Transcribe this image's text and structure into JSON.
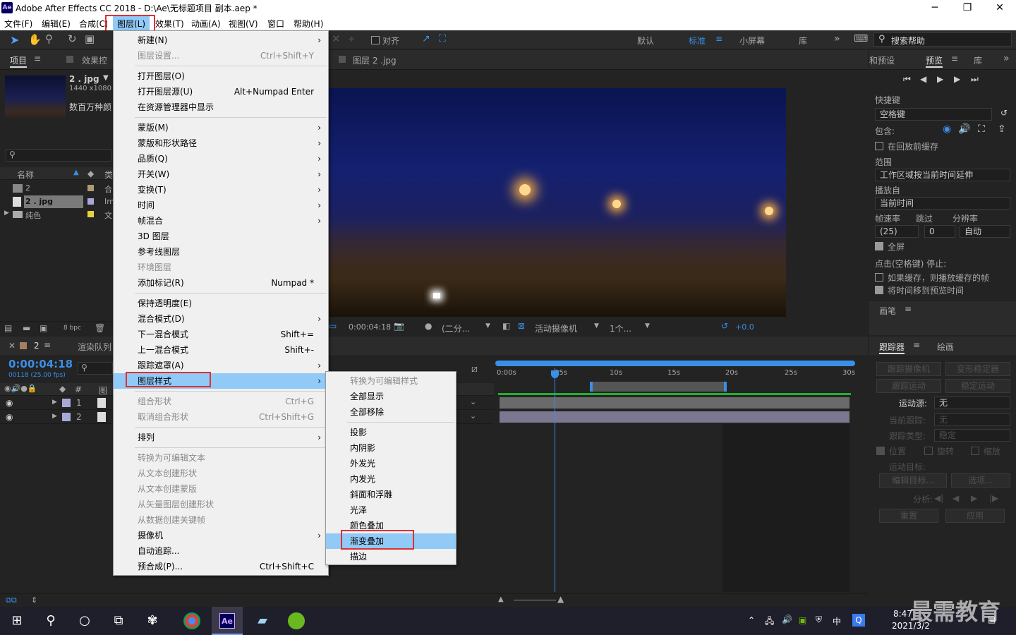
{
  "window": {
    "title": "Adobe After Effects CC 2018 - D:\\Ae\\无标题项目 副本.aep *",
    "logo": "Ae",
    "min": "─",
    "max": "❐",
    "close": "✕"
  },
  "menubar": [
    "文件(F)",
    "编辑(E)",
    "合成(C)",
    "图层(L)",
    "效果(T)",
    "动画(A)",
    "视图(V)",
    "窗口",
    "帮助(H)"
  ],
  "toolbar": {
    "snap": "对齐",
    "workspaces": [
      "默认",
      "标准",
      "小屏幕",
      "库"
    ],
    "active_ws": "标准",
    "search_placeholder": "搜索帮助"
  },
  "project": {
    "tab": "项目",
    "effects_tab": "效果控",
    "thumb_name": "2 . jpg",
    "thumb_res": "1440 x1080",
    "thumb_desc": "数百万种颜",
    "col_name": "名称",
    "col_type": "类",
    "items": [
      {
        "name": "2",
        "type": "合"
      },
      {
        "name": "2 . jpg",
        "type": "Im"
      },
      {
        "name": "纯色",
        "type": "文"
      }
    ],
    "bpc": "8 bpc"
  },
  "viewer": {
    "tab": "图层 2 .jpg",
    "time": "0:00:04:18",
    "res": "(二分...",
    "camera": "活动摄像机",
    "views": "1个...",
    "offset": "+0.0"
  },
  "timeline": {
    "tab": "2",
    "render_tab": "渲染队列",
    "timecode": "0:00:04:18",
    "fps": "00118 (25.00 fps)",
    "col_hash": "#",
    "col_layer": "图",
    "rows": [
      "1",
      "2"
    ],
    "ruler": [
      "0:00s",
      "05s",
      "10s",
      "15s",
      "20s",
      "25s",
      "30s"
    ]
  },
  "right": {
    "tab_presets": "和预设",
    "tab_preview": "预览",
    "tab_lib": "库",
    "shortcut_label": "快捷键",
    "shortcut_value": "空格键",
    "include_label": "包含:",
    "cache_before": "在回放前缓存",
    "range_label": "范围",
    "range_value": "工作区域按当前时间延伸",
    "play_from_label": "播放自",
    "play_from_value": "当前时间",
    "fps_label": "帧速率",
    "skip_label": "跳过",
    "res_label": "分辨率",
    "fps_value": "(25)",
    "skip_value": "0",
    "res_value": "自动",
    "fullscreen": "全屏",
    "stop_label": "点击(空格键) 停止:",
    "cache_play": "如果缓存，则播放缓存的帧",
    "move_time": "将时间移到预览时间",
    "paint_tab": "画笔",
    "tracker_tab": "跟踪器",
    "brush_tab": "绘画",
    "track_camera": "跟踪摄像机",
    "warp_stab": "变形稳定器",
    "track_motion": "跟踪运动",
    "stab_motion": "稳定运动",
    "motion_src_label": "运动源:",
    "motion_src": "无",
    "cur_track_label": "当前跟踪:",
    "cur_track": "无",
    "track_type_label": "跟踪类型:",
    "track_type": "稳定",
    "position": "位置",
    "rotation": "旋转",
    "scale": "缩放",
    "motion_target": "运动目标:",
    "edit_target": "编辑目标...",
    "options": "选项...",
    "analyze": "分析:",
    "reset": "重置",
    "apply": "应用"
  },
  "layer_menu": [
    {
      "label": "新建(N)",
      "arrow": true
    },
    {
      "label": "图层设置...",
      "sc": "Ctrl+Shift+Y",
      "dis": true
    },
    {
      "sep": true
    },
    {
      "label": "打开图层(O)"
    },
    {
      "label": "打开图层源(U)",
      "sc": "Alt+Numpad Enter"
    },
    {
      "label": "在资源管理器中显示"
    },
    {
      "sep": true
    },
    {
      "label": "蒙版(M)",
      "arrow": true
    },
    {
      "label": "蒙版和形状路径",
      "arrow": true
    },
    {
      "label": "品质(Q)",
      "arrow": true
    },
    {
      "label": "开关(W)",
      "arrow": true
    },
    {
      "label": "变换(T)",
      "arrow": true
    },
    {
      "label": "时间",
      "arrow": true
    },
    {
      "label": "帧混合",
      "arrow": true
    },
    {
      "label": "3D 图层"
    },
    {
      "label": "参考线图层"
    },
    {
      "label": "环境图层",
      "dis": true
    },
    {
      "label": "添加标记(R)",
      "sc": "Numpad *"
    },
    {
      "sep": true
    },
    {
      "label": "保持透明度(E)"
    },
    {
      "label": "混合模式(D)",
      "arrow": true
    },
    {
      "label": "下一混合模式",
      "sc": "Shift+="
    },
    {
      "label": "上一混合模式",
      "sc": "Shift+-"
    },
    {
      "label": "跟踪遮罩(A)",
      "arrow": true
    },
    {
      "label": "图层样式",
      "arrow": true,
      "hl": true
    },
    {
      "sep": true
    },
    {
      "label": "组合形状",
      "sc": "Ctrl+G",
      "dis": true
    },
    {
      "label": "取消组合形状",
      "sc": "Ctrl+Shift+G",
      "dis": true
    },
    {
      "sep": true
    },
    {
      "label": "排列",
      "arrow": true
    },
    {
      "sep": true
    },
    {
      "label": "转换为可编辑文本",
      "dis": true
    },
    {
      "label": "从文本创建形状",
      "dis": true
    },
    {
      "label": "从文本创建蒙版",
      "dis": true
    },
    {
      "label": "从矢量图层创建形状",
      "dis": true
    },
    {
      "label": "从数据创建关键帧",
      "dis": true
    },
    {
      "label": "摄像机",
      "arrow": true
    },
    {
      "label": "自动追踪..."
    },
    {
      "label": "预合成(P)...",
      "sc": "Ctrl+Shift+C"
    }
  ],
  "style_menu": [
    {
      "label": "转换为可编辑样式",
      "dis": true
    },
    {
      "label": "全部显示"
    },
    {
      "label": "全部移除"
    },
    {
      "sep": true
    },
    {
      "label": "投影"
    },
    {
      "label": "内阴影"
    },
    {
      "label": "外发光"
    },
    {
      "label": "内发光"
    },
    {
      "label": "斜面和浮雕"
    },
    {
      "label": "光泽"
    },
    {
      "label": "颜色叠加"
    },
    {
      "label": "渐变叠加",
      "hl": true
    },
    {
      "label": "描边"
    }
  ],
  "taskbar": {
    "time": "8:47",
    "date": "2021/3/2",
    "ime": "中",
    "watermark": "最需教育"
  }
}
